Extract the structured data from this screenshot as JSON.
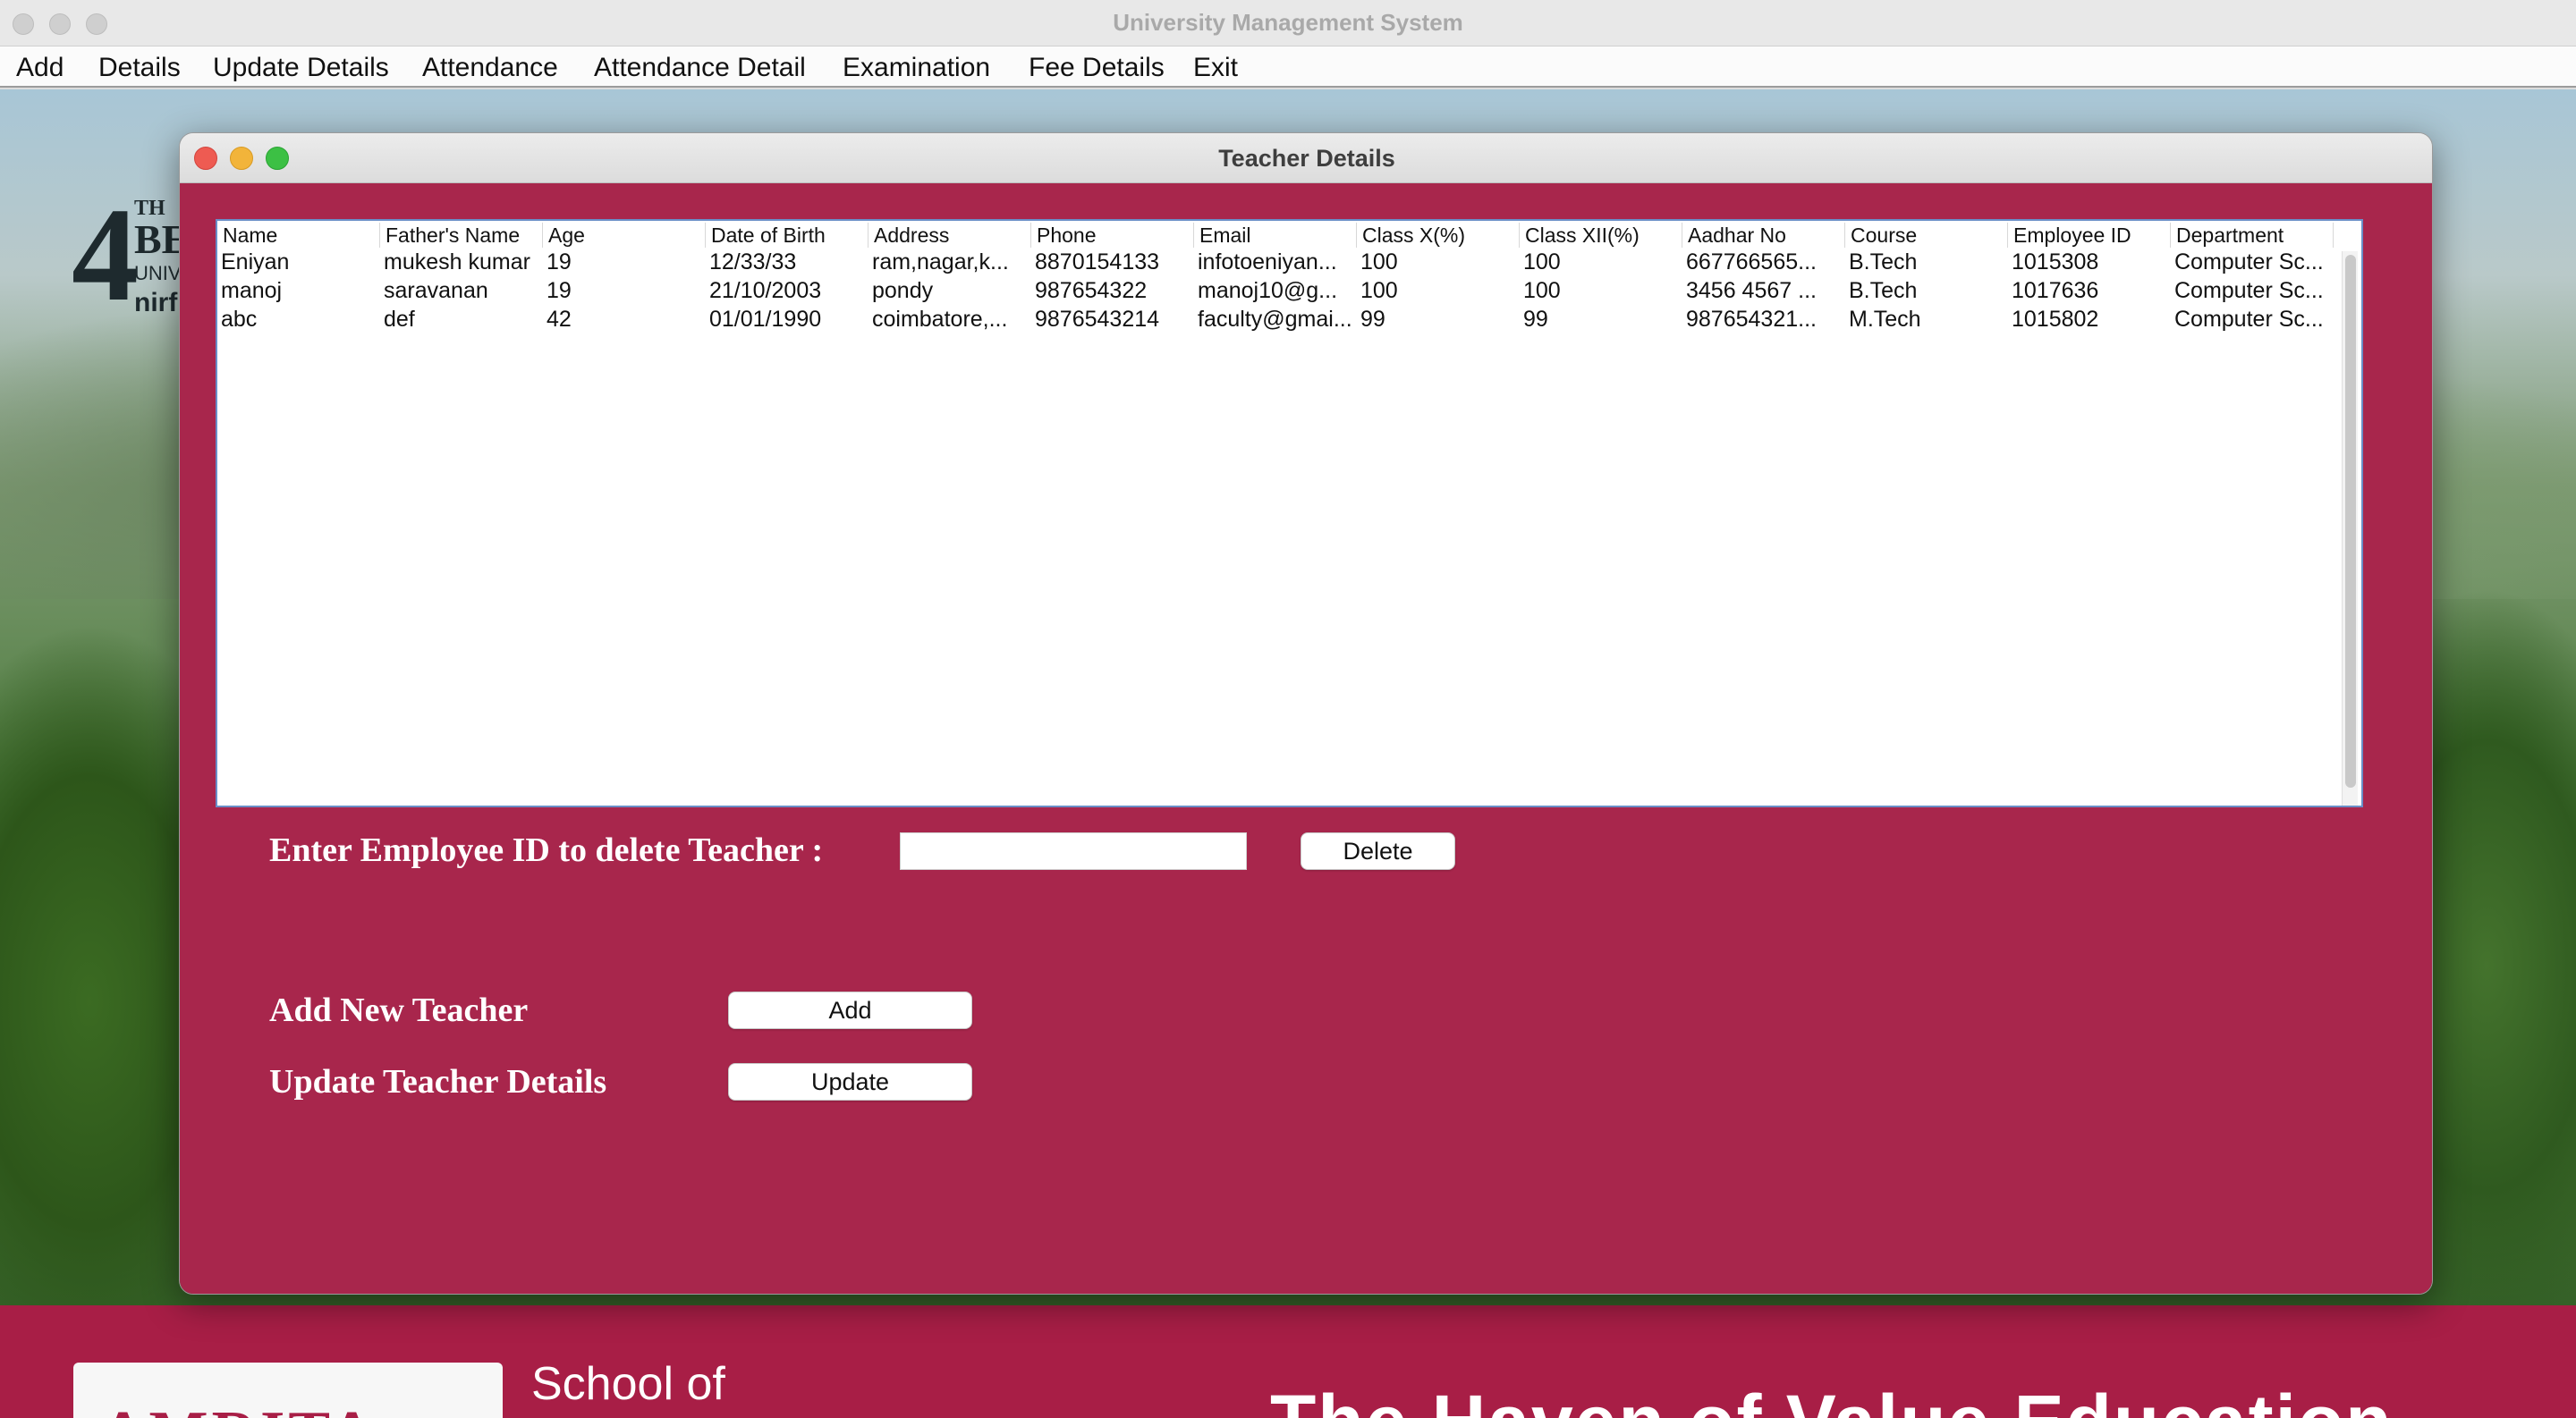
{
  "app": {
    "window_title": "University Management System"
  },
  "menubar": {
    "items": [
      "Add",
      "Details",
      "Update Details",
      "Attendance",
      "Attendance Detail",
      "Examination",
      "Fee Details",
      "Exit"
    ]
  },
  "background": {
    "logo_number": "4",
    "logo_th": "TH",
    "logo_be": "BE",
    "logo_univ": "UNIV",
    "logo_nirf": "nirf",
    "banner_logo": "AMRITA",
    "banner_school": "School of",
    "banner_tagline": "The Haven of Value Education"
  },
  "teacher_window": {
    "title": "Teacher Details",
    "table": {
      "columns": [
        "Name",
        "Father's Name",
        "Age",
        "Date of Birth",
        "Address",
        "Phone",
        "Email",
        "Class X(%)",
        "Class XII(%)",
        "Aadhar No",
        "Course",
        "Employee ID",
        "Department"
      ],
      "rows": [
        [
          "Eniyan",
          "mukesh kumar",
          "19",
          "12/33/33",
          "ram,nagar,k...",
          "8870154133",
          "infotoeniyan...",
          "100",
          "100",
          "667766565...",
          "B.Tech",
          "1015308",
          "Computer Sc..."
        ],
        [
          "manoj",
          "saravanan",
          "19",
          "21/10/2003",
          "pondy",
          "987654322",
          "manoj10@g...",
          "100",
          "100",
          "3456 4567 ...",
          "B.Tech",
          "1017636",
          "Computer Sc..."
        ],
        [
          "abc",
          "def",
          "42",
          "01/01/1990",
          "coimbatore,...",
          "9876543214",
          "faculty@gmai...",
          "99",
          "99",
          "987654321...",
          "M.Tech",
          "1015802",
          "Computer Sc..."
        ]
      ]
    },
    "delete_label": "Enter Employee ID to delete Teacher :",
    "delete_input_value": "",
    "delete_button": "Delete",
    "add_label": "Add New Teacher",
    "add_button": "Add",
    "update_label": "Update Teacher Details",
    "update_button": "Update"
  },
  "colors": {
    "window_body": "#a8264c",
    "banner": "#a81e46",
    "traffic_close": "#ee5b52",
    "traffic_min": "#f2b43a",
    "traffic_max": "#3cc044"
  }
}
